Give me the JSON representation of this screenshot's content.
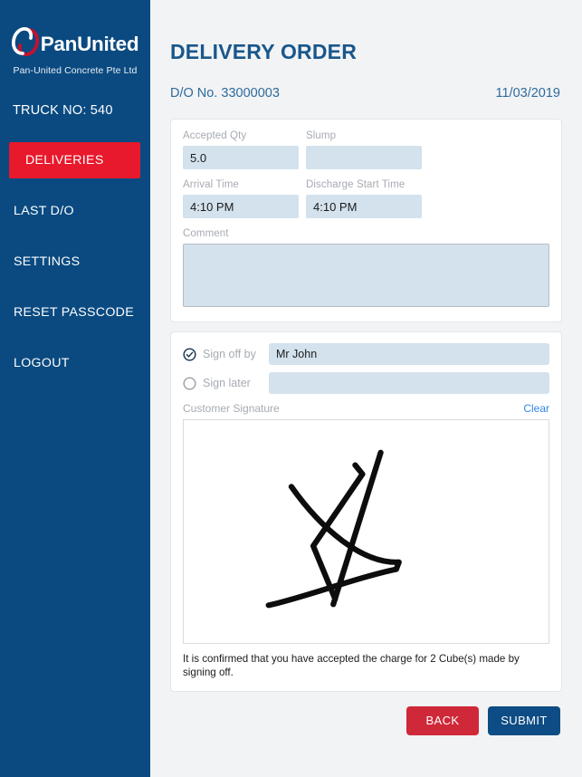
{
  "sidebar": {
    "brand": {
      "logo_icon": "panunited-loops-logo",
      "name": "PanUnited",
      "tagline": "Pan-United Concrete Pte Ltd"
    },
    "truck": {
      "label": "TRUCK NO:",
      "value": "540"
    },
    "nav_items": [
      {
        "label": "DELIVERIES",
        "active": true
      },
      {
        "label": "LAST D/O",
        "active": false
      },
      {
        "label": "SETTINGS",
        "active": false
      },
      {
        "label": "RESET PASSCODE",
        "active": false
      },
      {
        "label": "LOGOUT",
        "active": false
      }
    ]
  },
  "header": {
    "title": "DELIVERY ORDER",
    "do_number": "D/O No. 33000003",
    "date": "11/03/2019"
  },
  "details": {
    "accepted_qty": {
      "label": "Accepted Qty",
      "value": "5.0",
      "placeholder": ""
    },
    "slump": {
      "label": "Slump",
      "value": "",
      "placeholder": ""
    },
    "arrival_time": {
      "label": "Arrival Time",
      "value": "4:10 PM",
      "placeholder": ""
    },
    "discharge_start_time": {
      "label": "Discharge Start Time",
      "value": "4:10 PM",
      "placeholder": ""
    },
    "comment": {
      "label": "Comment",
      "value": "",
      "placeholder": ""
    }
  },
  "signoff": {
    "sign_off_by": {
      "label": "Sign off by",
      "value": "Mr John",
      "placeholder": "",
      "selected": true,
      "icon": "radio-checked-icon"
    },
    "sign_later": {
      "label": "Sign later",
      "value": "",
      "placeholder": "",
      "selected": false,
      "icon": "radio-unchecked-icon"
    },
    "signature": {
      "caption": "Customer Signature",
      "clear_label": "Clear",
      "has_signature": true
    },
    "confirmation_text": "It is confirmed that you have accepted the charge for 2 Cube(s) made by signing off."
  },
  "footer": {
    "back_label": "BACK",
    "submit_label": "SUBMIT"
  },
  "colors": {
    "sidebar_blue": "#0a4a80",
    "accent_red": "#e8192c",
    "button_red": "#cf2838",
    "button_blue": "#0d4c84",
    "title_blue": "#18578c",
    "input_blue": "#d3e2ed",
    "link_blue": "#3586e8",
    "page_bg": "#f2f3f5"
  }
}
